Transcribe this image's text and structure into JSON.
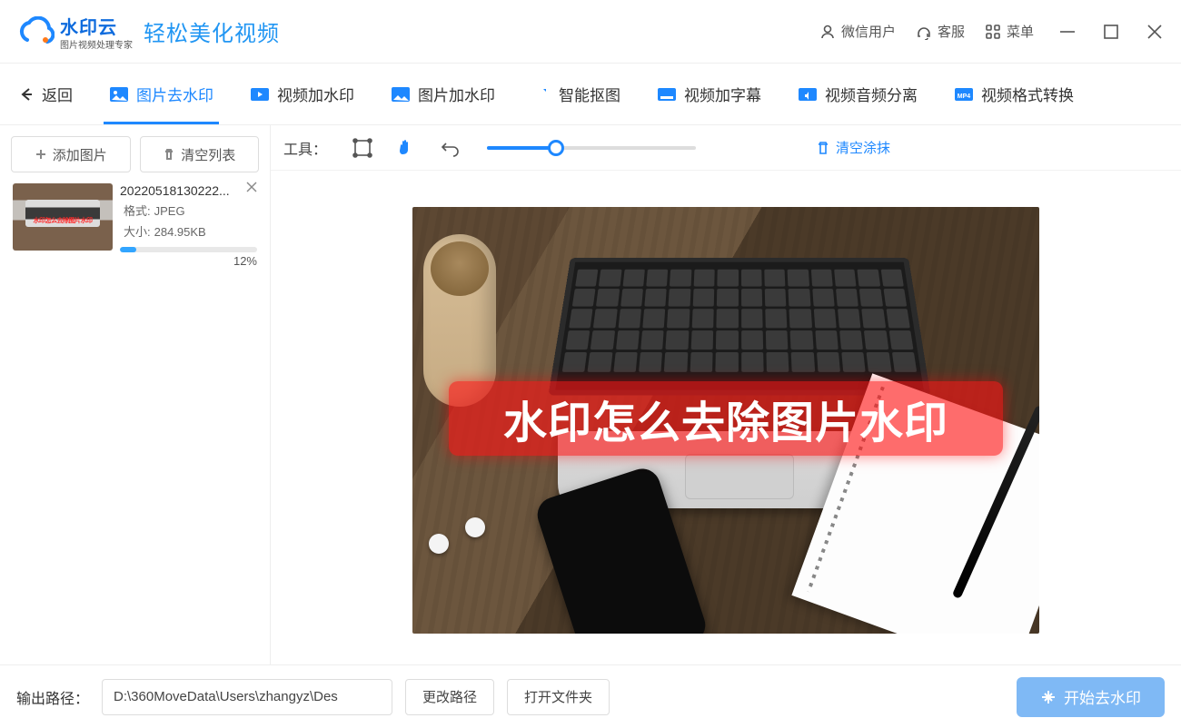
{
  "header": {
    "brand": "水印云",
    "brand_sub": "图片视频处理专家",
    "slogan": "轻松美化视频",
    "wechat": "微信用户",
    "support": "客服",
    "menu": "菜单"
  },
  "tabs": {
    "back": "返回",
    "items": [
      {
        "label": "图片去水印",
        "active": true
      },
      {
        "label": "视频加水印"
      },
      {
        "label": "图片加水印"
      },
      {
        "label": "智能抠图"
      },
      {
        "label": "视频加字幕"
      },
      {
        "label": "视频音频分离"
      },
      {
        "label": "视频格式转换"
      }
    ]
  },
  "sidebar": {
    "add": "添加图片",
    "clear": "清空列表",
    "item": {
      "thumb_text": "水印怎么去除图片水印",
      "filename": "20220518130222...",
      "fmt_label": "格式:",
      "fmt": "JPEG",
      "size_label": "大小:",
      "size": "284.95KB",
      "pct": "12%"
    }
  },
  "tools": {
    "label": "工具：",
    "clear": "清空涂抹"
  },
  "watermark": "水印怎么去除图片水印",
  "footer": {
    "label": "输出路径：",
    "path": "D:\\360MoveData\\Users\\zhangyz\\Des",
    "change": "更改路径",
    "open": "打开文件夹",
    "start": "开始去水印"
  }
}
